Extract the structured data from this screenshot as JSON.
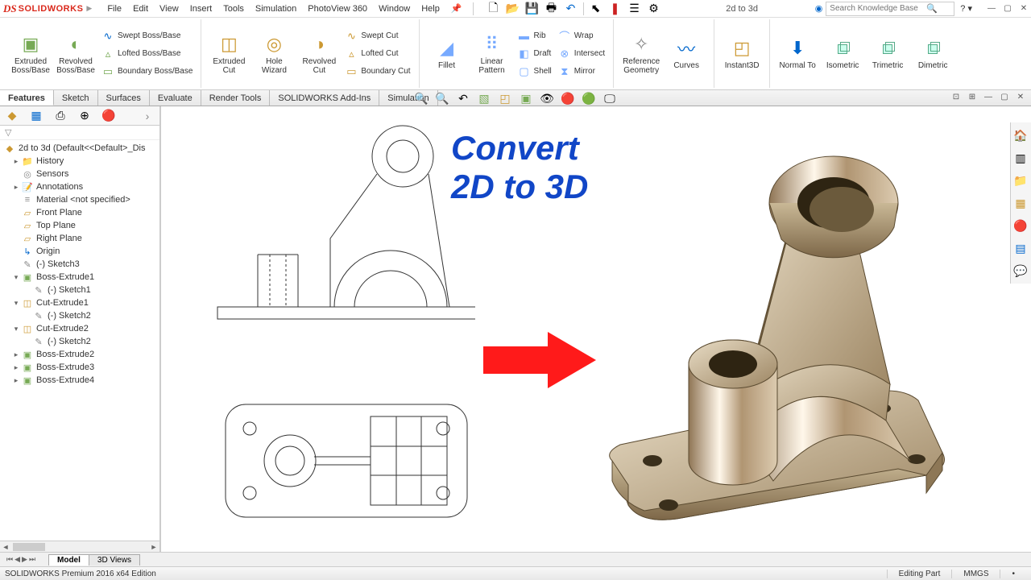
{
  "app": {
    "logo_ds": "DS",
    "logo_text": "SOLIDWORKS"
  },
  "menu": [
    "File",
    "Edit",
    "View",
    "Insert",
    "Tools",
    "Simulation",
    "PhotoView 360",
    "Window",
    "Help"
  ],
  "doc_title": "2d to 3d",
  "search": {
    "placeholder": "Search Knowledge Base"
  },
  "ribbon": {
    "extruded_boss": "Extruded Boss/Base",
    "revolved_boss": "Revolved Boss/Base",
    "swept_boss": "Swept Boss/Base",
    "lofted_boss": "Lofted Boss/Base",
    "boundary_boss": "Boundary Boss/Base",
    "extruded_cut": "Extruded Cut",
    "hole_wizard": "Hole Wizard",
    "revolved_cut": "Revolved Cut",
    "swept_cut": "Swept Cut",
    "lofted_cut": "Lofted Cut",
    "boundary_cut": "Boundary Cut",
    "fillet": "Fillet",
    "linear_pattern": "Linear Pattern",
    "rib": "Rib",
    "draft": "Draft",
    "shell": "Shell",
    "wrap": "Wrap",
    "intersect": "Intersect",
    "mirror": "Mirror",
    "ref_geo": "Reference Geometry",
    "curves": "Curves",
    "instant3d": "Instant3D",
    "normal_to": "Normal To",
    "isometric": "Isometric",
    "trimetric": "Trimetric",
    "dimetric": "Dimetric"
  },
  "tabs": [
    "Features",
    "Sketch",
    "Surfaces",
    "Evaluate",
    "Render Tools",
    "SOLIDWORKS Add-Ins",
    "Simulation"
  ],
  "tree": {
    "root": "2d to 3d  (Default<<Default>_Dis",
    "history": "History",
    "sensors": "Sensors",
    "annotations": "Annotations",
    "material": "Material <not specified>",
    "front": "Front Plane",
    "top": "Top Plane",
    "right": "Right Plane",
    "origin": "Origin",
    "sketch3": "(-) Sketch3",
    "bossex1": "Boss-Extrude1",
    "sketch1": "(-) Sketch1",
    "cutex1": "Cut-Extrude1",
    "sketch2a": "(-) Sketch2",
    "cutex2": "Cut-Extrude2",
    "sketch2b": "(-) Sketch2",
    "bossex2": "Boss-Extrude2",
    "bossex3": "Boss-Extrude3",
    "bossex4": "Boss-Extrude4"
  },
  "overlay": {
    "line1": "Convert",
    "line2": "2D to 3D"
  },
  "bottom_tabs": {
    "model": "Model",
    "views3d": "3D Views"
  },
  "status": {
    "edition": "SOLIDWORKS Premium 2016 x64 Edition",
    "mode": "Editing Part",
    "units": "MMGS"
  }
}
